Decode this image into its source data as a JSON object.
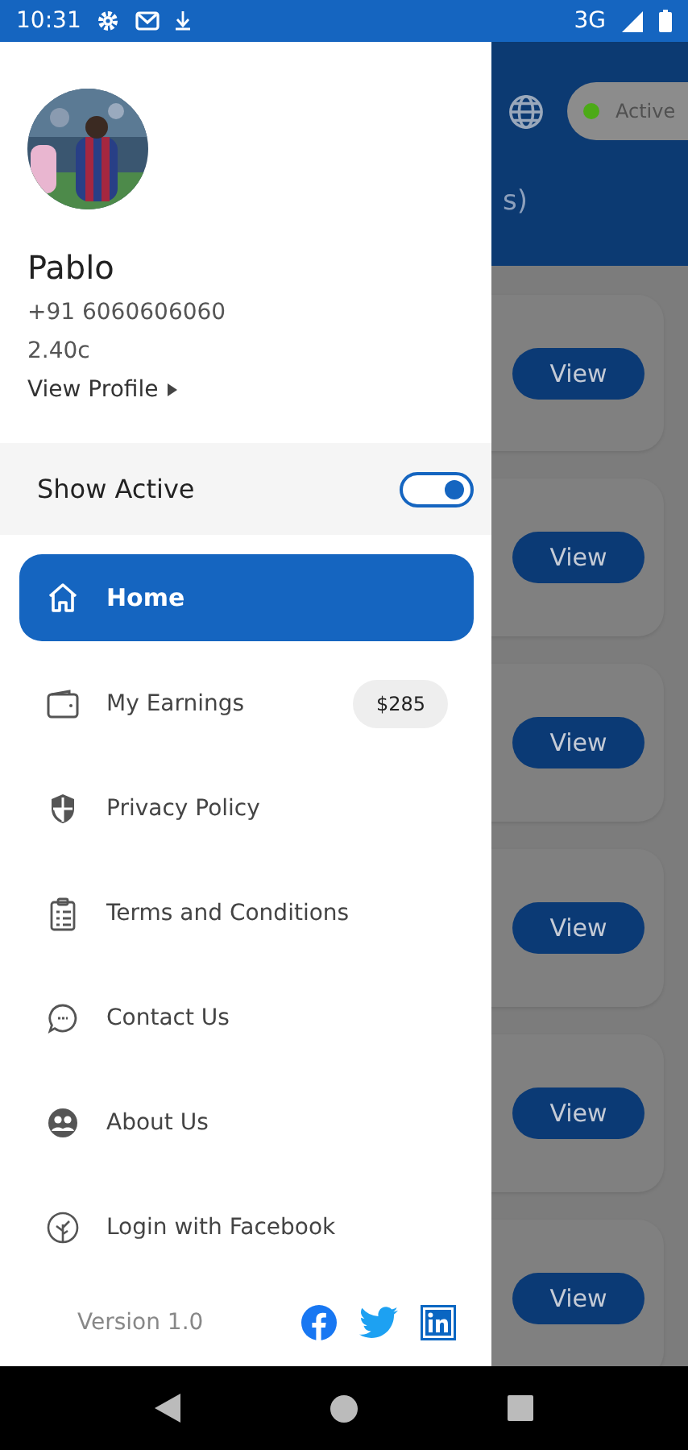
{
  "status_bar": {
    "time": "10:31",
    "network": "3G"
  },
  "drawer": {
    "profile": {
      "name": "Pablo",
      "phone": "+91 6060606060",
      "balance": "2.40c",
      "link": "View Profile"
    },
    "show_active": {
      "label": "Show Active",
      "on": true
    },
    "menu": [
      {
        "kind": "home",
        "label": "Home",
        "selected": true
      },
      {
        "kind": "wallet",
        "label": "My Earnings",
        "selected": false,
        "badge": "$285"
      },
      {
        "kind": "shield",
        "label": "Privacy Policy",
        "selected": false
      },
      {
        "kind": "clipboard",
        "label": "Terms and Conditions",
        "selected": false
      },
      {
        "kind": "chat",
        "label": "Contact Us",
        "selected": false
      },
      {
        "kind": "people",
        "label": "About Us",
        "selected": false
      },
      {
        "kind": "leaf",
        "label": "Login with Facebook",
        "selected": false
      }
    ],
    "footer": {
      "version": "Version 1.0"
    }
  },
  "background": {
    "header": {
      "status": "Active",
      "title_fragment": "s)"
    },
    "cards": [
      {
        "button": "View"
      },
      {
        "button": "View"
      },
      {
        "button": "View"
      },
      {
        "button": "View"
      },
      {
        "button": "View"
      },
      {
        "button": "View"
      }
    ]
  }
}
